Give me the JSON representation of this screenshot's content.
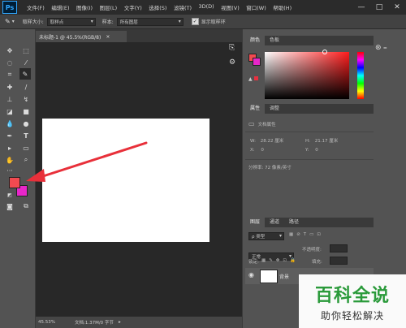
{
  "menubar": {
    "logo": "Ps",
    "items": [
      "文件(F)",
      "编辑(E)",
      "图像(I)",
      "图层(L)",
      "文字(Y)",
      "选择(S)",
      "滤镜(T)",
      "3D(D)",
      "视图(V)",
      "窗口(W)",
      "帮助(H)"
    ],
    "window_buttons": [
      "—",
      "□",
      "✕"
    ]
  },
  "options": {
    "sample_size_label": "取样大小:",
    "sample_size_value": "取样点",
    "sample_label": "样本:",
    "sample_value": "所有图层",
    "ring_label": "显示取样环"
  },
  "document": {
    "tab_title": "未标题-1 @ 45.5%(RGB/8)",
    "zoom": "45.53%",
    "doc_info": "文档:1.37M/0 字节"
  },
  "color_panel": {
    "tabs": [
      "颜色",
      "色板"
    ],
    "foreground": "#f24a50",
    "background": "#e826c9"
  },
  "properties_panel": {
    "tabs": [
      "属性",
      "调整"
    ],
    "section_title": "文档属性",
    "width_label": "W:",
    "width_value": "28.22 厘米",
    "height_label": "H:",
    "height_value": "21.17 厘米",
    "x_label": "X:",
    "x_value": "0",
    "y_label": "Y:",
    "y_value": "0",
    "resolution": "分辨率: 72 像素/英寸"
  },
  "layers_panel": {
    "tabs": [
      "图层",
      "通道",
      "路径"
    ],
    "filter_placeholder": "ρ 类型",
    "blend_mode": "正常",
    "opacity_label": "不透明度:",
    "lock_label": "锁定:",
    "fill_label": "填充:",
    "layer_name": "背景"
  },
  "watermark": {
    "big": "百科全说",
    "small": "助你轻松解决"
  }
}
